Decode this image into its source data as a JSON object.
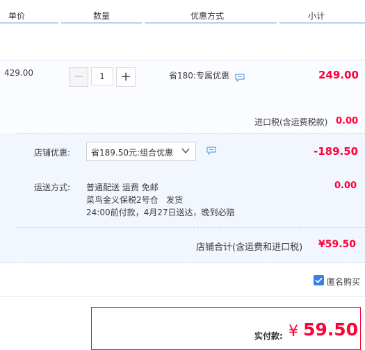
{
  "header": {
    "col_price": "单价",
    "col_qty": "数量",
    "col_promo": "优惠方式",
    "col_subtotal": "小计"
  },
  "item": {
    "unit_price": "429.00",
    "quantity": "1",
    "promo": "省180:专属优惠",
    "subtotal": "249.00",
    "tax_label": "进口税(含运费税款)",
    "tax_value": "0.00"
  },
  "shop": {
    "discount_label": "店铺优惠:",
    "discount_selected": "省189.50元:组合优惠",
    "discount_value": "-189.50",
    "shipping_label": "运送方式:",
    "shipping_line1": "普通配送 运费 免邮",
    "shipping_line2": "菜鸟金义保税2号仓   发货",
    "shipping_line3": "24:00前付款，4月27日送达，晚到必赔",
    "shipping_value": "0.00",
    "total_label": "店铺合计(含运费和进口税)",
    "total_value": "¥59.50"
  },
  "anonymous": {
    "label": "匿名购买",
    "checked": true
  },
  "payment": {
    "label": "实付款:",
    "currency": "¥",
    "amount": "59.50"
  },
  "colors": {
    "accent_red": "#ff0036",
    "checkbox_blue": "#3d7fe0",
    "shop_bg": "#f2f7ff"
  }
}
